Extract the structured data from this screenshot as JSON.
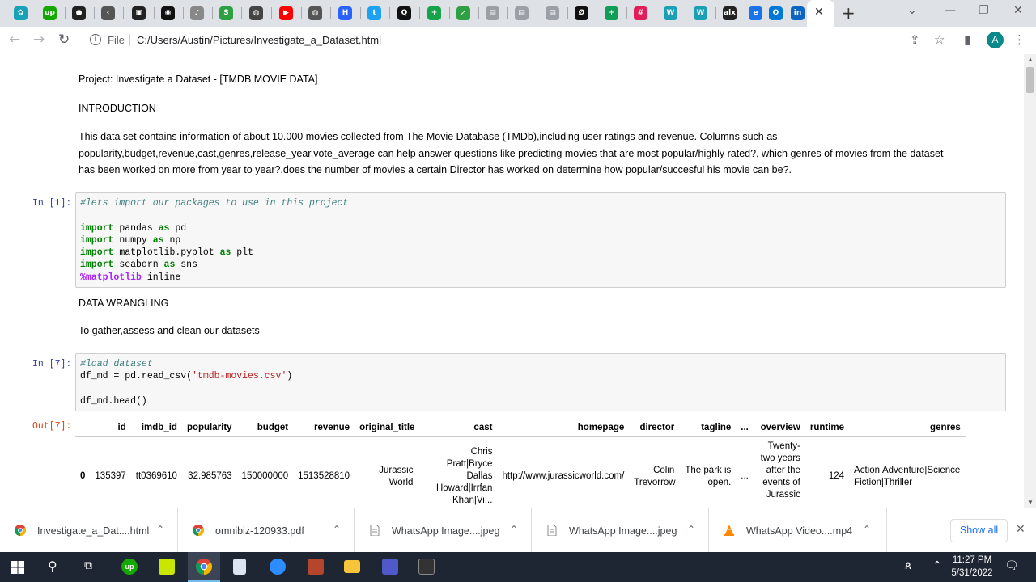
{
  "browser": {
    "tab_icons": [
      {
        "icon": "teal-flower-icon",
        "color": "#17a2b8",
        "glyph": "✿"
      },
      {
        "icon": "upwork-icon",
        "color": "#14a800",
        "glyph": "up"
      },
      {
        "icon": "black-cat-icon",
        "color": "#222222",
        "glyph": "●"
      },
      {
        "icon": "chevron-left-icon",
        "color": "#555555",
        "glyph": "‹"
      },
      {
        "icon": "terminal-icon",
        "color": "#222222",
        "glyph": "▣"
      },
      {
        "icon": "github-icon",
        "color": "#111111",
        "glyph": "◉"
      },
      {
        "icon": "music-icon",
        "color": "#888888",
        "glyph": "♪"
      },
      {
        "icon": "s-icon",
        "color": "#2ea043",
        "glyph": "S"
      },
      {
        "icon": "globe-icon",
        "color": "#444444",
        "glyph": "◍"
      },
      {
        "icon": "youtube-icon",
        "color": "#ff0000",
        "glyph": "▶"
      },
      {
        "icon": "globe-icon",
        "color": "#555555",
        "glyph": "◍"
      },
      {
        "icon": "hashnode-icon",
        "color": "#2962ff",
        "glyph": "H"
      },
      {
        "icon": "twitter-icon",
        "color": "#1da1f2",
        "glyph": "t"
      },
      {
        "icon": "search-q-icon",
        "color": "#111111",
        "glyph": "Q"
      },
      {
        "icon": "plus-circle-icon",
        "color": "#16a34a",
        "glyph": "+"
      },
      {
        "icon": "arrow-icon",
        "color": "#2ea043",
        "glyph": "➚"
      },
      {
        "icon": "doc-icon",
        "color": "#9aa0a6",
        "glyph": "▤"
      },
      {
        "icon": "doc-icon",
        "color": "#9aa0a6",
        "glyph": "▤"
      },
      {
        "icon": "doc-icon",
        "color": "#9aa0a6",
        "glyph": "▤"
      },
      {
        "icon": "zeta-icon",
        "color": "#111111",
        "glyph": "Ø"
      },
      {
        "icon": "sheets-plus-icon",
        "color": "#0f9d58",
        "glyph": "+"
      },
      {
        "icon": "slack-icon",
        "color": "#e01e5a",
        "glyph": "#"
      },
      {
        "icon": "w-icon",
        "color": "#1a9fb5",
        "glyph": "W"
      },
      {
        "icon": "w-icon",
        "color": "#1a9fb5",
        "glyph": "W"
      },
      {
        "icon": "alx-icon",
        "color": "#222222",
        "glyph": "alx"
      },
      {
        "icon": "edge-doc-icon",
        "color": "#1a73e8",
        "glyph": "e"
      },
      {
        "icon": "outlook-icon",
        "color": "#0078d4",
        "glyph": "O"
      },
      {
        "icon": "linkedin-icon",
        "color": "#0a66c2",
        "glyph": "in"
      }
    ],
    "file_label": "File",
    "url": "C:/Users/Austin/Pictures/Investigate_a_Dataset.html",
    "avatar_letter": "A"
  },
  "notebook": {
    "title": "Project: Investigate a Dataset - [TMDB MOVIE DATA]",
    "intro_heading": "INTRODUCTION",
    "intro_lines": [
      "This data set contains information of about 10.000 movies collected from The Movie Database (TMDb),including user ratings and revenue. Columns such as",
      "popularity,budget,revenue,cast,genres,release_year,vote_average can help answer questions like predicting movies that are most popular/highly rated?, which genres of movies from the dataset",
      "has been worked on more from year to year?.does the number of movies a certain Director has worked on determine how popular/succesful his movie can be?."
    ],
    "cell1_prompt": "In [1]:",
    "cell1": {
      "comment": "#lets import our packages to use in this project",
      "lines": [
        {
          "kw": "import",
          "a": "pandas",
          "kw2": "as",
          "b": "pd"
        },
        {
          "kw": "import",
          "a": "numpy",
          "kw2": "as",
          "b": "np"
        },
        {
          "kw": "import",
          "a": "matplotlib.pyplot",
          "kw2": "as",
          "b": "plt"
        },
        {
          "kw": "import",
          "a": "seaborn",
          "kw2": "as",
          "b": "sns"
        }
      ],
      "magic": "%matplotlib",
      "magic_arg": "inline"
    },
    "wrangling_heading": "DATA WRANGLING",
    "wrangling_text": "To gather,assess and clean our datasets",
    "cell7_prompt": "In [7]:",
    "cell7": {
      "comment": "#load dataset",
      "line2_prefix": "df_md = pd.read_csv(",
      "line2_string": "'tmdb-movies.csv'",
      "line2_suffix": ")",
      "line3": "df_md.head()"
    },
    "out_prompt": "Out[7]:",
    "table": {
      "headers": [
        "",
        "id",
        "imdb_id",
        "popularity",
        "budget",
        "revenue",
        "original_title",
        "cast",
        "homepage",
        "director",
        "tagline",
        "...",
        "overview",
        "runtime",
        "genres"
      ],
      "rows": [
        [
          "0",
          "135397",
          "tt0369610",
          "32.985763",
          "150000000",
          "1513528810",
          "Jurassic World",
          "Chris Pratt|Bryce Dallas Howard|Irrfan Khan|Vi...",
          "http://www.jurassicworld.com/",
          "Colin Trevorrow",
          "The park is open.",
          "...",
          "Twenty-two years after the events of Jurassic ...",
          "124",
          "Action|Adventure|Science Fiction|Thriller"
        ]
      ]
    }
  },
  "downloads": [
    {
      "name": "Investigate_a_Dat....html",
      "icon": "chrome-icon"
    },
    {
      "name": "omnibiz-120933.pdf",
      "icon": "chrome-icon"
    },
    {
      "name": "WhatsApp Image....jpeg",
      "icon": "file-icon"
    },
    {
      "name": "WhatsApp Image....jpeg",
      "icon": "file-icon"
    },
    {
      "name": "WhatsApp Video....mp4",
      "icon": "vlc-icon"
    }
  ],
  "show_all": "Show all",
  "taskbar": {
    "time": "11:27 PM",
    "date": "5/31/2022"
  }
}
